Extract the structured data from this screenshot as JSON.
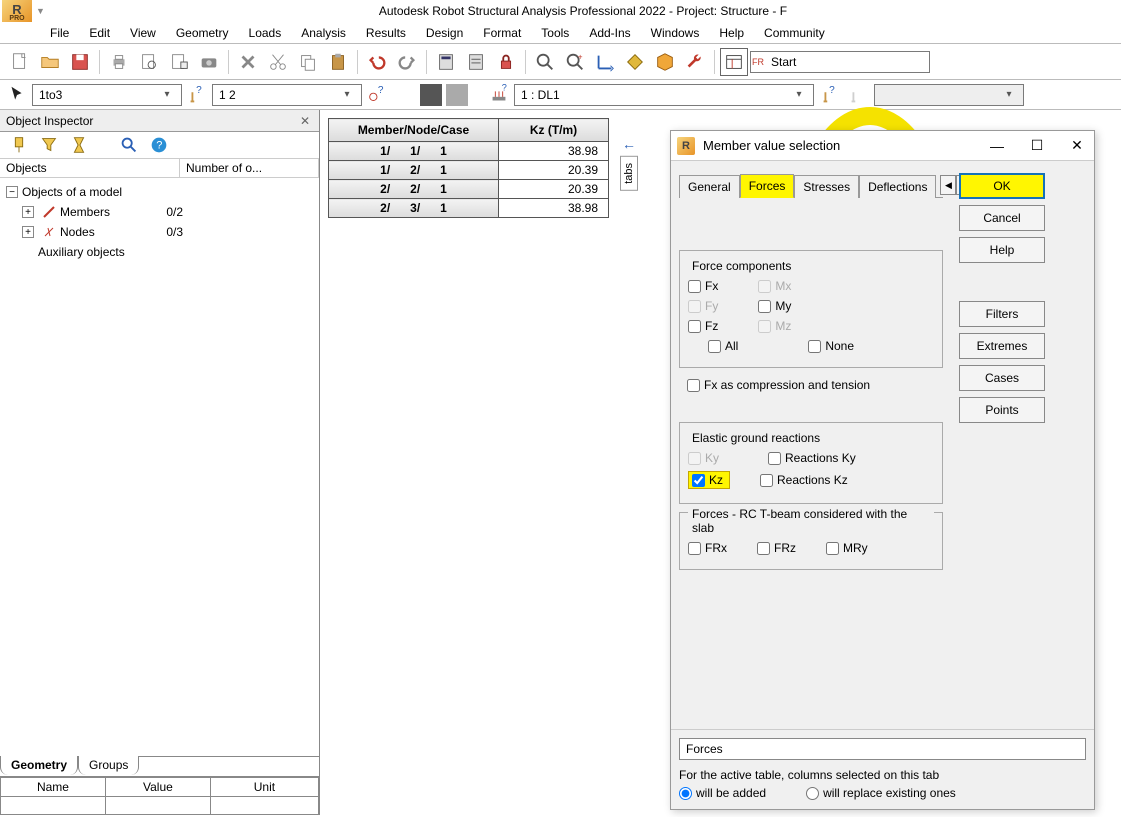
{
  "title": "Autodesk Robot Structural Analysis Professional 2022 - Project: Structure - F",
  "logo_text": "PRO",
  "menu": [
    "File",
    "Edit",
    "View",
    "Geometry",
    "Loads",
    "Analysis",
    "Results",
    "Design",
    "Format",
    "Tools",
    "Add-Ins",
    "Windows",
    "Help",
    "Community"
  ],
  "selector1": "1to3",
  "selector2": "1 2",
  "load_case": "1 : DL1",
  "layout_field": "Start",
  "inspector": {
    "title": "Object Inspector",
    "columns": [
      "Objects",
      "Number of o..."
    ],
    "tree": {
      "root": "Objects of a model",
      "items": [
        {
          "icon": "member",
          "label": "Members",
          "count": "0/2"
        },
        {
          "icon": "node",
          "label": "Nodes",
          "count": "0/3"
        }
      ],
      "aux": "Auxiliary objects"
    },
    "tabs": [
      "Geometry",
      "Groups"
    ],
    "props_headers": [
      "Name",
      "Value",
      "Unit"
    ]
  },
  "data_table": {
    "columns": [
      "Member/Node/Case",
      "Kz (T/m)"
    ],
    "rows": [
      {
        "rh": "1/      1/      1",
        "kz": "38.98"
      },
      {
        "rh": "1/      2/      1",
        "kz": "20.39"
      },
      {
        "rh": "2/      2/      1",
        "kz": "20.39"
      },
      {
        "rh": "2/      3/      1",
        "kz": "38.98"
      }
    ]
  },
  "side_tab": "tabs",
  "dialog": {
    "title": "Member value selection",
    "tabs": [
      "General",
      "Forces",
      "Stresses",
      "Deflections"
    ],
    "active_tab": "Forces",
    "force_components": {
      "legend": "Force components",
      "items": [
        "Fx",
        "Fy",
        "Fz",
        "Mx",
        "My",
        "Mz"
      ],
      "all": "All",
      "none": "None",
      "compression": "Fx as compression and tension"
    },
    "elastic": {
      "legend": "Elastic ground reactions",
      "items": [
        "Ky",
        "Kz",
        "Reactions Ky",
        "Reactions Kz"
      ]
    },
    "rc_tbeam": {
      "legend": "Forces - RC T-beam considered with the slab",
      "items": [
        "FRx",
        "FRz",
        "MRy"
      ]
    },
    "buttons": {
      "ok": "OK",
      "cancel": "Cancel",
      "help": "Help",
      "filters": "Filters",
      "extremes": "Extremes",
      "cases": "Cases",
      "points": "Points"
    },
    "footer": {
      "field_value": "Forces",
      "hint": "For the active table, columns selected on this tab",
      "radio1": "will be added",
      "radio2": "will replace existing ones"
    }
  }
}
